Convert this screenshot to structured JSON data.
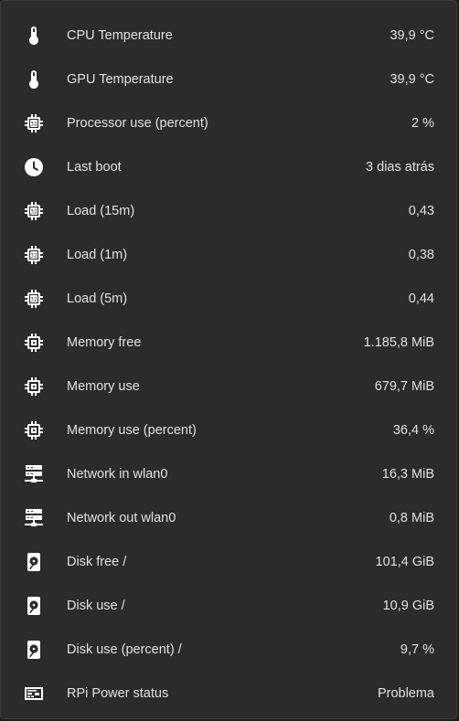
{
  "colors": {
    "card_background": "#2b2b2b",
    "text": "#e1e1e1",
    "icon": "#ffffff"
  },
  "rows": [
    {
      "icon": "thermometer-icon",
      "label": "CPU Temperature",
      "value": "39,9 °C"
    },
    {
      "icon": "thermometer-icon",
      "label": "GPU Temperature",
      "value": "39,9 °C"
    },
    {
      "icon": "cpu-icon",
      "label": "Processor use (percent)",
      "value": "2 %"
    },
    {
      "icon": "clock-icon",
      "label": "Last boot",
      "value": "3 dias atrás"
    },
    {
      "icon": "cpu-icon",
      "label": "Load (15m)",
      "value": "0,43"
    },
    {
      "icon": "cpu-icon",
      "label": "Load (1m)",
      "value": "0,38"
    },
    {
      "icon": "cpu-icon",
      "label": "Load (5m)",
      "value": "0,44"
    },
    {
      "icon": "memory-icon",
      "label": "Memory free",
      "value": "1.185,8 MiB"
    },
    {
      "icon": "memory-icon",
      "label": "Memory use",
      "value": "679,7 MiB"
    },
    {
      "icon": "memory-icon",
      "label": "Memory use (percent)",
      "value": "36,4 %"
    },
    {
      "icon": "server-network-icon",
      "label": "Network in wlan0",
      "value": "16,3 MiB"
    },
    {
      "icon": "server-network-icon",
      "label": "Network out wlan0",
      "value": "0,8 MiB"
    },
    {
      "icon": "harddisk-icon",
      "label": "Disk free /",
      "value": "101,4 GiB"
    },
    {
      "icon": "harddisk-icon",
      "label": "Disk use /",
      "value": "10,9 GiB"
    },
    {
      "icon": "harddisk-icon",
      "label": "Disk use (percent) /",
      "value": "9,7 %"
    },
    {
      "icon": "raspberry-pi-board-icon",
      "label": "RPi Power status",
      "value": "Problema"
    }
  ]
}
